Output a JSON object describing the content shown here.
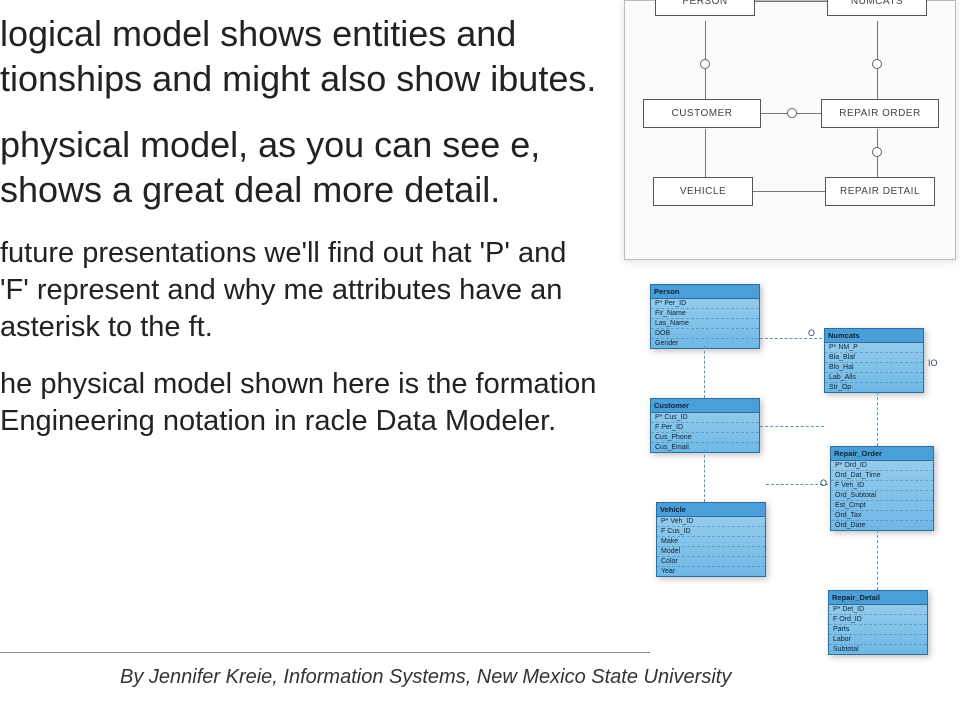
{
  "paragraphs": {
    "p1": "logical model shows entities and tionships and might also show ibutes.",
    "p2": "physical model, as you can see e, shows a great deal more detail.",
    "p3": "future presentations we'll find out hat 'P' and 'F' represent and why me attributes have an asterisk to the ft.",
    "p4": "he physical model shown here is the formation Engineering notation in racle Data Modeler."
  },
  "byline": "By Jennifer Kreie, Information Systems, New Mexico State University",
  "logical_boxes": {
    "b1": "PERSON",
    "b2": "NUMCATS",
    "b3": "CUSTOMER",
    "b4": "REPAIR ORDER",
    "b5": "VEHICLE",
    "b6": "REPAIR DETAIL"
  },
  "physical": {
    "person": {
      "title": "Person",
      "rows": [
        "P*  Per_ID",
        "   Fir_Name",
        "   Las_Name",
        "   DOB",
        "   Gender"
      ]
    },
    "numcats": {
      "title": "Numcats",
      "rows": [
        "P*  NM_P",
        "   Bla_Blaf",
        "   Blo_Hal",
        "   Lab_Alls",
        "   Str_Op"
      ]
    },
    "customer": {
      "title": "Customer",
      "rows": [
        "P*  Cus_ID",
        "F   Per_ID",
        "   Cus_Phone",
        "   Cus_Email"
      ]
    },
    "repair_order": {
      "title": "Repair_Order",
      "rows": [
        "P*  Ord_ID",
        "   Ord_Dat_Time",
        "F   Veh_ID",
        "   Ord_Subtotal",
        "   Est_Cmpt",
        "   Ord_Tax",
        "   Ord_Date"
      ]
    },
    "vehicle": {
      "title": "Vehicle",
      "rows": [
        "P*  Veh_ID",
        "F   Cus_ID",
        "   Make",
        "   Model",
        "   Color",
        "   Year"
      ]
    },
    "repair_detail": {
      "title": "Repair_Detail",
      "rows": [
        "P*  Det_ID",
        "F   Ord_ID",
        "   Parts",
        "   Labor",
        "   Subtotal"
      ]
    }
  },
  "annotations": {
    "o": "O",
    "io": "IO"
  }
}
